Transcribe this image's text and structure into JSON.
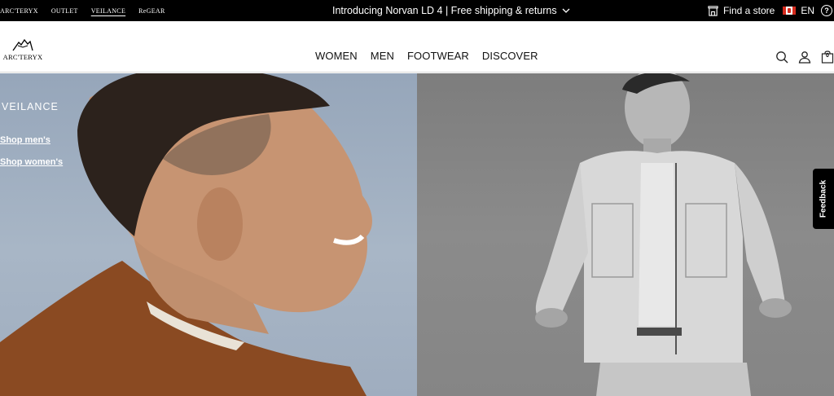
{
  "topbar": {
    "brand_links": [
      "ARC'TERYX",
      "OUTLET",
      "VEILANCE",
      "ReGEAR"
    ],
    "active_brand": "VEILANCE",
    "announcement": "Introducing Norvan LD 4 | Free shipping & returns",
    "find_store": "Find a store",
    "language": "EN"
  },
  "header": {
    "logo_text": "ARC'TERYX",
    "nav": [
      "WOMEN",
      "MEN",
      "FOOTWEAR",
      "DISCOVER"
    ],
    "bag_count": "0"
  },
  "hero": {
    "brand": "VEILANCE",
    "shop_men": "Shop men's",
    "shop_women": "Shop women's"
  },
  "feedback": "Feedback",
  "colors": {
    "topbar_bg": "#000000",
    "hero_left_bg": "#a0afc1",
    "hero_right_bg": "#848484",
    "flag_red": "#d52b1e"
  },
  "icons": [
    "chevron-down-icon",
    "store-icon",
    "canada-flag-icon",
    "help-icon",
    "search-icon",
    "account-icon",
    "bag-icon",
    "arcteryx-logo-icon"
  ]
}
